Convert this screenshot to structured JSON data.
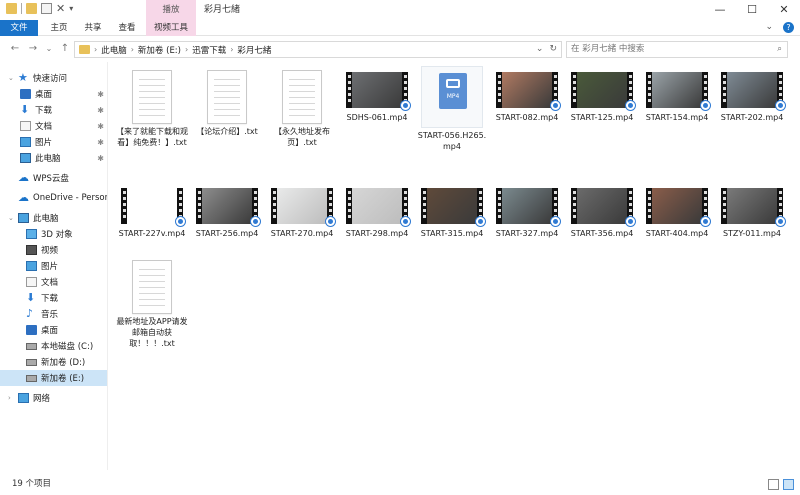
{
  "window": {
    "title": "彩月七緒",
    "context_tab": "播放",
    "controls": {
      "minimize": "—",
      "maximize": "☐",
      "close": "✕"
    }
  },
  "ribbon": {
    "tabs": [
      "文件",
      "主页",
      "共享",
      "查看",
      "视频工具"
    ],
    "help": "?"
  },
  "address": {
    "crumbs": [
      "此电脑",
      "新加卷 (E:)",
      "迅雷下载",
      "彩月七緒"
    ],
    "search_placeholder": "在 彩月七緒 中搜索"
  },
  "sidebar": {
    "items": [
      {
        "label": "快速访问",
        "icon": "star-icon"
      },
      {
        "label": "桌面",
        "icon": "desktop-icon",
        "pinned": "📌"
      },
      {
        "label": "下载",
        "icon": "download-icon",
        "pinned": "📌"
      },
      {
        "label": "文档",
        "icon": "documents-icon",
        "pinned": "📌"
      },
      {
        "label": "图片",
        "icon": "pictures-icon",
        "pinned": "📌"
      },
      {
        "label": "此电脑",
        "icon": "computer-icon",
        "pinned": "📌"
      },
      {
        "label": "WPS云盘",
        "icon": "cloud-icon"
      },
      {
        "label": "OneDrive - Persona",
        "icon": "onedrive-icon"
      },
      {
        "label": "此电脑",
        "icon": "computer-icon"
      },
      {
        "label": "3D 对象",
        "icon": "3d-objects-icon"
      },
      {
        "label": "视频",
        "icon": "videos-icon"
      },
      {
        "label": "图片",
        "icon": "pictures-icon"
      },
      {
        "label": "文档",
        "icon": "documents-icon"
      },
      {
        "label": "下载",
        "icon": "download-icon"
      },
      {
        "label": "音乐",
        "icon": "music-icon"
      },
      {
        "label": "桌面",
        "icon": "desktop-icon"
      },
      {
        "label": "本地磁盘 (C:)",
        "icon": "drive-icon"
      },
      {
        "label": "新加卷 (D:)",
        "icon": "drive-icon"
      },
      {
        "label": "新加卷 (E:)",
        "icon": "drive-icon"
      },
      {
        "label": "网络",
        "icon": "network-icon"
      }
    ]
  },
  "files": [
    {
      "name": "【来了就能下载和观看】纯免费！】.txt",
      "kind": "txt"
    },
    {
      "name": "【论坛介绍】.txt",
      "kind": "txt"
    },
    {
      "name": "【永久地址发布页】.txt",
      "kind": "txt"
    },
    {
      "name": "SDHS-061.mp4",
      "kind": "video",
      "tint": "#6d6f72"
    },
    {
      "name": "START-056.H265.mp4",
      "kind": "mp4icon",
      "tag": "MP4"
    },
    {
      "name": "START-082.mp4",
      "kind": "video",
      "tint": "#b07a62"
    },
    {
      "name": "START-125.mp4",
      "kind": "video",
      "tint": "#4a5a3a"
    },
    {
      "name": "START-154.mp4",
      "kind": "video",
      "tint": "#9aa3a8"
    },
    {
      "name": "START-202.mp4",
      "kind": "video",
      "tint": "#7f8b95"
    },
    {
      "name": "START-227v.mp4",
      "kind": "video",
      "tint": "#ffffff"
    },
    {
      "name": "START-256.mp4",
      "kind": "video",
      "tint": "#8d8d8d"
    },
    {
      "name": "START-270.mp4",
      "kind": "video",
      "tint": "#e9eaea"
    },
    {
      "name": "START-298.mp4",
      "kind": "video",
      "tint": "#d6d6d6"
    },
    {
      "name": "START-315.mp4",
      "kind": "video",
      "tint": "#5f4a3a"
    },
    {
      "name": "START-327.mp4",
      "kind": "video",
      "tint": "#7b8a8f"
    },
    {
      "name": "START-356.mp4",
      "kind": "video",
      "tint": "#6b6b6b"
    },
    {
      "name": "START-404.mp4",
      "kind": "video",
      "tint": "#8a5d4a"
    },
    {
      "name": "STZY-011.mp4",
      "kind": "video",
      "tint": "#7a7a7a"
    },
    {
      "name": "最新地址及APP请发邮箱自动获取！！！.txt",
      "kind": "txt"
    }
  ],
  "status": {
    "count": "19 个项目"
  }
}
